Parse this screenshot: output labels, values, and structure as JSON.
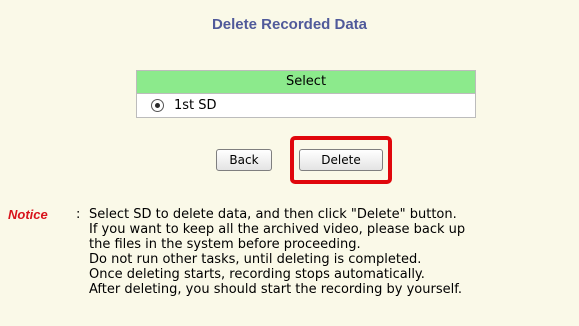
{
  "page": {
    "title": "Delete Recorded Data"
  },
  "select_table": {
    "header": "Select",
    "option_label": "1st SD",
    "option_selected": true
  },
  "buttons": {
    "back_label": "Back",
    "delete_label": "Delete"
  },
  "highlight": {
    "color": "#e0070c",
    "target": "delete-button"
  },
  "notice": {
    "label": "Notice",
    "separator": ":",
    "lines": [
      "Select SD to delete data, and then click \"Delete\" button.",
      "If you want to keep all the archived video, please back up",
      "the files in the system before proceeding.",
      "Do not run other tasks, until deleting is completed.",
      "Once deleting starts, recording stops automatically.",
      "After deleting, you should start the recording by yourself."
    ]
  },
  "colors": {
    "background": "#faf9e8",
    "title": "#505a9a",
    "header_green": "#8cea8c",
    "notice_red": "#d8141c"
  }
}
